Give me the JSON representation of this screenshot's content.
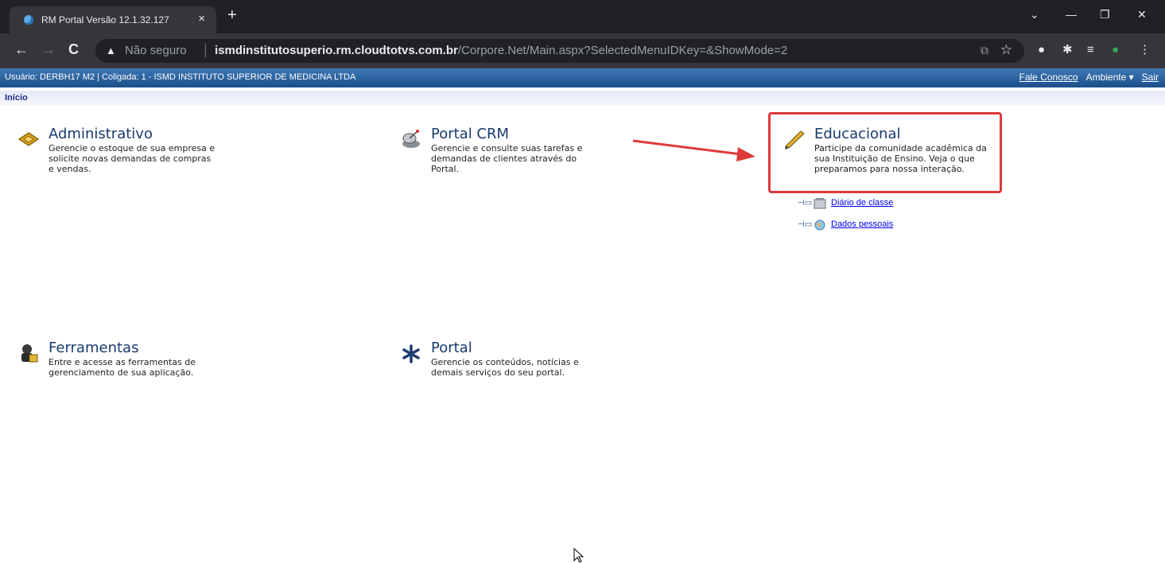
{
  "browser": {
    "tab_title": "RM Portal Versão 12.1.32.127",
    "tab_close": "×",
    "new_tab": "+",
    "security_label": "Não seguro",
    "url_host": "ismdinstitutosuperio.rm.cloudtotvs.com.br",
    "url_path": "/Corpore.Net/Main.aspx?SelectedMenuIDKey=&ShowMode=2"
  },
  "userbar": {
    "info": "Usuário: DERBH17 M2  |  Coligada: 1 - ISMD INSTITUTO SUPERIOR DE MEDICINA LTDA",
    "fale_conosco": "Fale Conosco",
    "ambiente": "Ambiente ▾",
    "sair": "Sair"
  },
  "breadcrumb": "Início",
  "modules": {
    "administrativo": {
      "title": "Administrativo",
      "desc": "Gerencie o estoque de sua empresa e solicite novas demandas de compras e vendas."
    },
    "portal_crm": {
      "title": "Portal CRM",
      "desc": "Gerencie e consulte suas tarefas e demandas de clientes através do Portal."
    },
    "educacional": {
      "title": "Educacional",
      "desc": "Participe da comunidade acadêmica da sua Instituição de Ensino. Veja o que preparamos para nossa interação.",
      "links": [
        "Diário de classe",
        "Dados pessoais"
      ]
    },
    "ferramentas": {
      "title": "Ferramentas",
      "desc": "Entre e acesse as ferramentas de gerenciamento de sua aplicação."
    },
    "portal": {
      "title": "Portal",
      "desc": "Gerencie os conteúdos, notícias e demais serviços do seu portal."
    }
  },
  "colors": {
    "header_blue": "#1b4f8a",
    "annotation_red": "#de3a3a",
    "title_blue": "#173a6e"
  },
  "icons": [
    "administrativo-icon",
    "satellite-icon",
    "pencil-icon",
    "tools-icon",
    "asterisk-icon",
    "book-icon",
    "globe-icon"
  ]
}
